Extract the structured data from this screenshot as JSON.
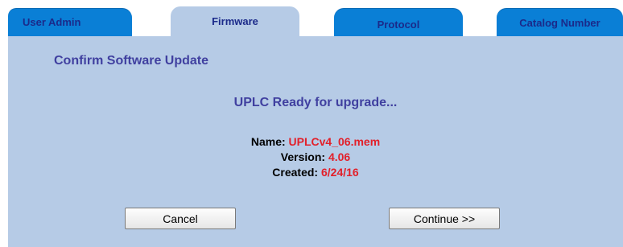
{
  "tabs": [
    {
      "label": "User Admin",
      "active": false
    },
    {
      "label": "Firmware",
      "active": true
    },
    {
      "label": "Protocol",
      "active": false
    },
    {
      "label": "Catalog Number",
      "active": false
    }
  ],
  "dialog": {
    "heading": "Confirm Software Update",
    "status": "UPLC Ready for upgrade...",
    "fields": {
      "name": {
        "label": "Name:",
        "value": "UPLCv4_06.mem"
      },
      "version": {
        "label": "Version:",
        "value": "4.06"
      },
      "created": {
        "label": "Created:",
        "value": "6/24/16"
      }
    },
    "buttons": {
      "cancel": "Cancel",
      "continue": "Continue >>"
    }
  },
  "colors": {
    "panel_bg": "#b6cbe6",
    "tab_inactive_bg": "#0a7fd6",
    "heading_text": "#4040a0",
    "value_text": "#e2202a"
  }
}
